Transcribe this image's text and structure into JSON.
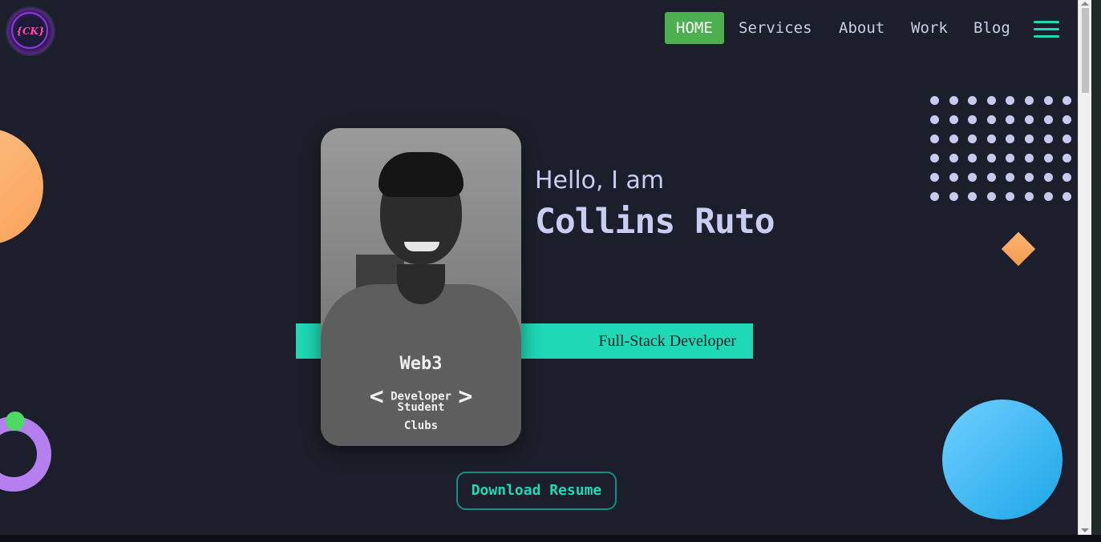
{
  "logo": {
    "text": "{CK}",
    "icon": "ck-logo-icon"
  },
  "nav": {
    "items": [
      {
        "label": "HOME",
        "active": true
      },
      {
        "label": "Services",
        "active": false
      },
      {
        "label": "About",
        "active": false
      },
      {
        "label": "Work",
        "active": false
      },
      {
        "label": "Blog",
        "active": false
      }
    ],
    "menu_icon": "hamburger-menu-icon"
  },
  "hero": {
    "greeting": "Hello, I am",
    "name": "Collins Ruto",
    "role": "Full-Stack Developer",
    "photo": {
      "shirt_lines": [
        "Web3",
        "Developer",
        "Student",
        "Clubs"
      ]
    },
    "download_label": "Download Resume"
  },
  "colors": {
    "background": "#1c1f2b",
    "accent_teal": "#1ed8b6",
    "nav_active": "#4caf50",
    "text_light": "#c9cdf2",
    "orange": "#f9a25a",
    "purple": "#b57ff0",
    "blue": "#1da6e8"
  }
}
